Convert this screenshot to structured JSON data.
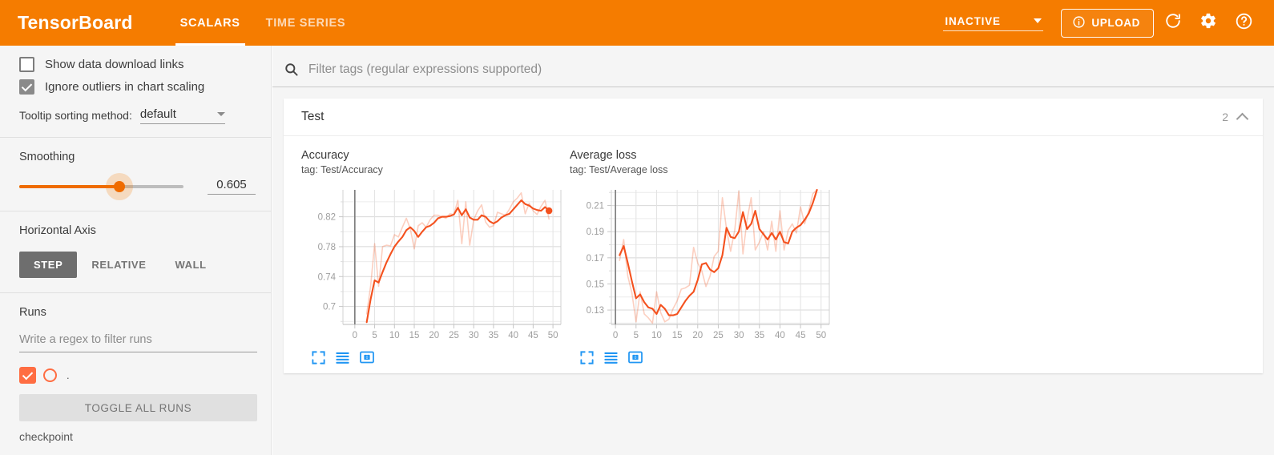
{
  "header": {
    "brand": "TensorBoard",
    "tabs": [
      {
        "label": "SCALARS",
        "active": true
      },
      {
        "label": "TIME SERIES",
        "active": false
      }
    ],
    "status": "INACTIVE",
    "upload_label": "UPLOAD",
    "icons": {
      "info": "info-icon",
      "reload": "reload-icon",
      "settings": "gear-icon",
      "help": "help-icon",
      "dropdown": "chevron-down-icon"
    },
    "colors": {
      "bar": "#f57c00",
      "accent": "#ff6d42",
      "link": "#2196f3"
    }
  },
  "sidebar": {
    "show_download_links": {
      "label": "Show data download links",
      "checked": false
    },
    "ignore_outliers": {
      "label": "Ignore outliers in chart scaling",
      "checked": true
    },
    "tooltip_sort": {
      "label": "Tooltip sorting method:",
      "value": "default"
    },
    "smoothing": {
      "title": "Smoothing",
      "value": "0.605",
      "percent": 61
    },
    "horizontal_axis": {
      "title": "Horizontal Axis",
      "options": [
        {
          "label": "STEP",
          "active": true
        },
        {
          "label": "RELATIVE",
          "active": false
        },
        {
          "label": "WALL",
          "active": false
        }
      ]
    },
    "runs": {
      "title": "Runs",
      "filter_placeholder": "Write a regex to filter runs",
      "filter_value": "",
      "items": [
        {
          "name": ".",
          "checked": true
        }
      ],
      "toggle_label": "TOGGLE ALL RUNS",
      "checkpoint_label": "checkpoint"
    }
  },
  "main": {
    "search": {
      "placeholder": "Filter tags (regular expressions supported)",
      "value": ""
    },
    "card": {
      "title": "Test",
      "count": "2",
      "collapse_icon": "chevron-up-icon"
    },
    "chart_buttons": [
      {
        "name": "expand-chart-button"
      },
      {
        "name": "toggle-lines-button"
      },
      {
        "name": "fit-domain-button"
      }
    ]
  },
  "chart_data": [
    {
      "type": "line",
      "title": "Accuracy",
      "subtitle": "tag: Test/Accuracy",
      "xlabel": "",
      "ylabel": "",
      "xlim": [
        -3,
        52
      ],
      "ylim": [
        0.676,
        0.856
      ],
      "xticks": [
        0,
        5,
        10,
        15,
        20,
        25,
        30,
        35,
        40,
        45,
        50
      ],
      "yticks": [
        0.7,
        0.74,
        0.78,
        0.82
      ],
      "grid": true,
      "legend": "none",
      "series": [
        {
          "name": "smoothed",
          "color": "#f4511e",
          "opacity": 1,
          "x": [
            3,
            4,
            5,
            6,
            7,
            8,
            9,
            10,
            11,
            12,
            13,
            14,
            15,
            16,
            17,
            18,
            19,
            20,
            21,
            22,
            23,
            24,
            25,
            26,
            27,
            28,
            29,
            30,
            31,
            32,
            33,
            34,
            35,
            36,
            37,
            38,
            39,
            40,
            41,
            42,
            43,
            44,
            45,
            46,
            47,
            48,
            49
          ],
          "y": [
            0.679,
            0.71,
            0.735,
            0.732,
            0.746,
            0.759,
            0.77,
            0.78,
            0.787,
            0.793,
            0.802,
            0.806,
            0.801,
            0.793,
            0.8,
            0.806,
            0.808,
            0.812,
            0.818,
            0.82,
            0.82,
            0.821,
            0.823,
            0.832,
            0.822,
            0.83,
            0.819,
            0.816,
            0.816,
            0.822,
            0.82,
            0.814,
            0.811,
            0.814,
            0.819,
            0.822,
            0.824,
            0.83,
            0.836,
            0.842,
            0.837,
            0.835,
            0.831,
            0.829,
            0.828,
            0.833,
            0.828
          ]
        },
        {
          "name": "raw",
          "color": "#f4511e",
          "opacity": 0.28,
          "x": [
            3,
            4,
            5,
            6,
            7,
            8,
            9,
            10,
            11,
            12,
            13,
            14,
            15,
            16,
            17,
            18,
            19,
            20,
            21,
            22,
            23,
            24,
            25,
            26,
            27,
            28,
            29,
            30,
            31,
            32,
            33,
            34,
            35,
            36,
            37,
            38,
            39,
            40,
            41,
            42,
            43,
            44,
            45,
            46,
            47,
            48,
            49
          ],
          "y": [
            0.69,
            0.728,
            0.784,
            0.727,
            0.78,
            0.782,
            0.781,
            0.796,
            0.793,
            0.806,
            0.818,
            0.804,
            0.777,
            0.808,
            0.812,
            0.806,
            0.816,
            0.822,
            0.822,
            0.82,
            0.818,
            0.824,
            0.823,
            0.842,
            0.784,
            0.84,
            0.782,
            0.816,
            0.828,
            0.836,
            0.813,
            0.806,
            0.808,
            0.826,
            0.824,
            0.822,
            0.83,
            0.84,
            0.845,
            0.852,
            0.824,
            0.838,
            0.828,
            0.823,
            0.834,
            0.842,
            0.817
          ]
        }
      ],
      "last_point": {
        "x": 49,
        "y": 0.828
      }
    },
    {
      "type": "line",
      "title": "Average loss",
      "subtitle": "tag: Test/Average loss",
      "xlabel": "",
      "ylabel": "",
      "xlim": [
        -1,
        52
      ],
      "ylim": [
        0.119,
        0.222
      ],
      "xticks": [
        0,
        5,
        10,
        15,
        20,
        25,
        30,
        35,
        40,
        45,
        50
      ],
      "yticks": [
        0.13,
        0.15,
        0.17,
        0.19,
        0.21
      ],
      "grid": true,
      "legend": "none",
      "series": [
        {
          "name": "smoothed",
          "color": "#f4511e",
          "opacity": 1,
          "x": [
            1,
            2,
            3,
            4,
            5,
            6,
            7,
            8,
            9,
            10,
            11,
            12,
            13,
            14,
            15,
            16,
            17,
            18,
            19,
            20,
            21,
            22,
            23,
            24,
            25,
            26,
            27,
            28,
            29,
            30,
            31,
            32,
            33,
            34,
            35,
            36,
            37,
            38,
            39,
            40,
            41,
            42,
            43,
            44,
            45,
            46,
            47,
            48,
            49
          ],
          "y": [
            0.172,
            0.179,
            0.166,
            0.152,
            0.139,
            0.142,
            0.136,
            0.132,
            0.131,
            0.127,
            0.134,
            0.131,
            0.126,
            0.126,
            0.127,
            0.132,
            0.137,
            0.141,
            0.144,
            0.153,
            0.165,
            0.166,
            0.161,
            0.159,
            0.162,
            0.172,
            0.193,
            0.186,
            0.185,
            0.19,
            0.205,
            0.192,
            0.196,
            0.206,
            0.192,
            0.188,
            0.184,
            0.189,
            0.184,
            0.19,
            0.182,
            0.181,
            0.19,
            0.193,
            0.195,
            0.199,
            0.204,
            0.212,
            0.222
          ]
        },
        {
          "name": "raw",
          "color": "#f4511e",
          "opacity": 0.28,
          "x": [
            1,
            2,
            3,
            4,
            5,
            6,
            7,
            8,
            9,
            10,
            11,
            12,
            13,
            14,
            15,
            16,
            17,
            18,
            19,
            20,
            21,
            22,
            23,
            24,
            25,
            26,
            27,
            28,
            29,
            30,
            31,
            32,
            33,
            34,
            35,
            36,
            37,
            38,
            39,
            40,
            41,
            42,
            43,
            44,
            45,
            46,
            47,
            48,
            49
          ],
          "y": [
            0.168,
            0.184,
            0.156,
            0.143,
            0.121,
            0.144,
            0.127,
            0.124,
            0.12,
            0.144,
            0.128,
            0.121,
            0.123,
            0.131,
            0.137,
            0.146,
            0.147,
            0.149,
            0.178,
            0.166,
            0.16,
            0.148,
            0.156,
            0.171,
            0.175,
            0.216,
            0.192,
            0.175,
            0.191,
            0.221,
            0.173,
            0.199,
            0.216,
            0.176,
            0.182,
            0.19,
            0.176,
            0.198,
            0.175,
            0.206,
            0.176,
            0.191,
            0.196,
            0.189,
            0.209,
            0.196,
            0.206,
            0.219,
            0.222
          ]
        }
      ],
      "last_point": null
    }
  ]
}
